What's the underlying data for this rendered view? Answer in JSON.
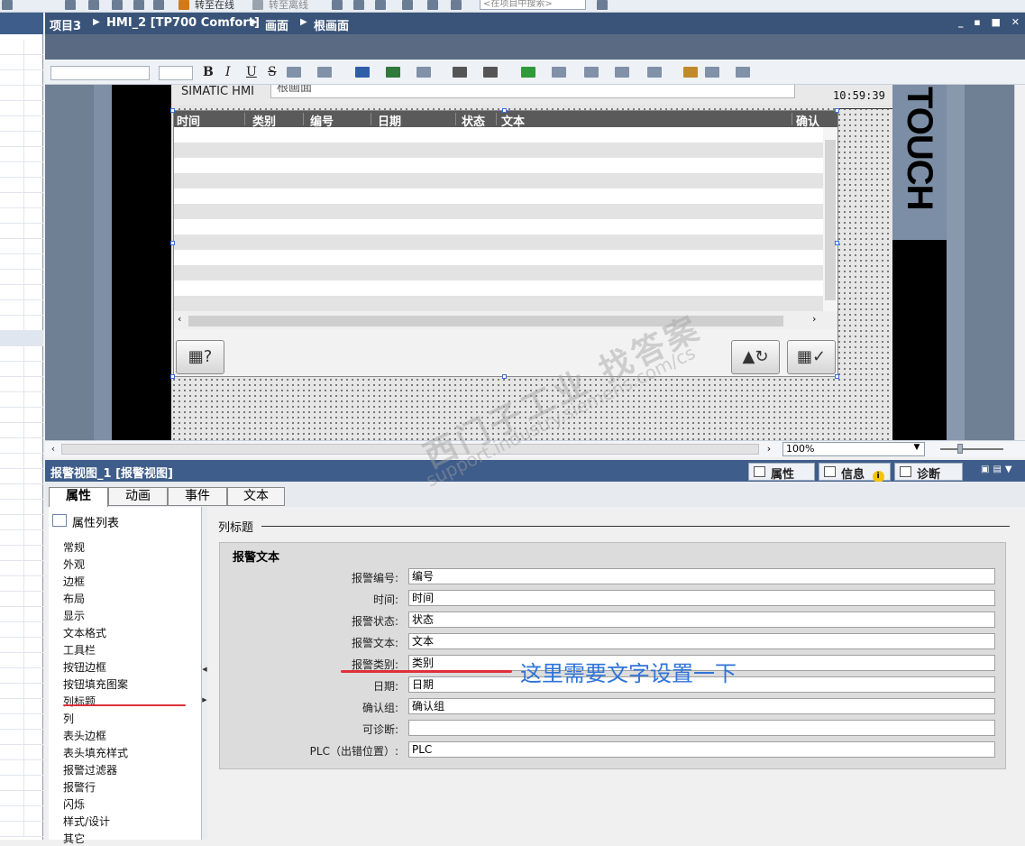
{
  "topbar": {
    "go_online": "转至在线",
    "go_offline": "转至离线",
    "search_placeholder": "<在项目中搜索>"
  },
  "breadcrumb": {
    "items": [
      "项目3",
      "HMI_2 [TP700 Comfort]",
      "画面",
      "根画面"
    ],
    "window_controls": "_ ▪ ■ ✕"
  },
  "format_toolbar": {
    "bold": "B",
    "italic": "I",
    "underline": "U",
    "strike": "S"
  },
  "hmi_screen": {
    "brand": "SIMATIC HMI",
    "screen_title": "根画面",
    "clock": "10:59:39",
    "device_label": "TOUCH",
    "alarm_columns": [
      "时间",
      "类别",
      "编号",
      "日期",
      "状态",
      "文本",
      "确认"
    ],
    "row_count": 12
  },
  "canvas_bar": {
    "zoom": "100%"
  },
  "inspector": {
    "title": "报警视图_1 [报警视图]",
    "right_tabs": {
      "properties": "属性",
      "info": "信息",
      "info_badge": "i",
      "diagnostics": "诊断"
    },
    "tabs": [
      "属性",
      "动画",
      "事件",
      "文本"
    ],
    "active_tab": "属性",
    "nav_header": "属性列表",
    "nav_items": [
      "常规",
      "外观",
      "边框",
      "布局",
      "显示",
      "文本格式",
      "工具栏",
      "按钮边框",
      "按钮填充图案",
      "列标题",
      "列",
      "表头边框",
      "表头填充样式",
      "报警过滤器",
      "报警行",
      "闪烁",
      "样式/设计",
      "其它"
    ],
    "selected_nav": "列标题",
    "section_title": "列标题",
    "group_title": "报警文本",
    "fields": [
      {
        "label": "报警编号:",
        "value": "编号"
      },
      {
        "label": "时间:",
        "value": "时间"
      },
      {
        "label": "报警状态:",
        "value": "状态"
      },
      {
        "label": "报警文本:",
        "value": "文本"
      },
      {
        "label": "报警类别:",
        "value": "类别"
      },
      {
        "label": "日期:",
        "value": "日期"
      },
      {
        "label": "确认组:",
        "value": "确认组"
      },
      {
        "label": "可诊断:",
        "value": ""
      },
      {
        "label": "PLC（出错位置）:",
        "value": "PLC"
      }
    ]
  },
  "annotation": {
    "note": "这里需要文字设置一下",
    "color": "#2f74d8",
    "underline_color": "#e0303a"
  },
  "watermark": {
    "line1": "西门子工业  找答案",
    "line2": "support.industry.siemens.com/cs"
  }
}
